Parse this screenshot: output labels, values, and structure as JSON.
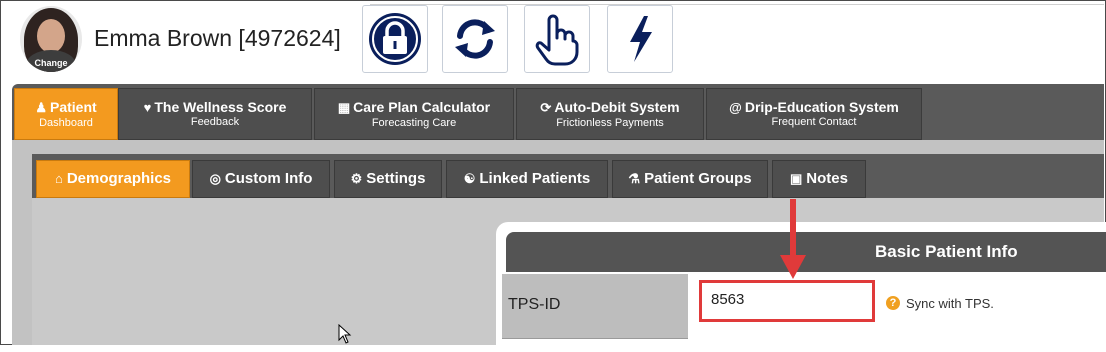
{
  "header": {
    "avatar_label": "Change",
    "patient_name": "Emma Brown [4972624]",
    "tools": [
      {
        "icon": "lock-icon"
      },
      {
        "icon": "refresh-icon"
      },
      {
        "icon": "hand-pointer-icon"
      },
      {
        "icon": "lightning-icon"
      }
    ]
  },
  "main_tabs": [
    {
      "icon": "user-icon",
      "title": "Patient",
      "subtitle": "Dashboard",
      "active": true
    },
    {
      "icon": "heartbeat-icon",
      "title": "The Wellness Score",
      "subtitle": "Feedback",
      "active": false
    },
    {
      "icon": "calculator-icon",
      "title": "Care Plan Calculator",
      "subtitle": "Forecasting Care",
      "active": false
    },
    {
      "icon": "sync-icon",
      "title": "Auto-Debit System",
      "subtitle": "Frictionless Payments",
      "active": false
    },
    {
      "icon": "at-icon",
      "title": "Drip-Education System",
      "subtitle": "Frequent Contact",
      "active": false
    }
  ],
  "sub_tabs": [
    {
      "icon": "home-icon",
      "label": "Demographics",
      "active": true
    },
    {
      "icon": "bullseye-icon",
      "label": "Custom Info",
      "active": false
    },
    {
      "icon": "gear-icon",
      "label": "Settings",
      "active": false
    },
    {
      "icon": "users-icon",
      "label": "Linked Patients",
      "active": false
    },
    {
      "icon": "flask-icon",
      "label": "Patient Groups",
      "active": false
    },
    {
      "icon": "note-icon",
      "label": "Notes",
      "active": false
    }
  ],
  "card": {
    "title": "Basic Patient Info",
    "field_label": "TPS-ID",
    "field_value": "8563",
    "help_text": "Sync with TPS."
  },
  "colors": {
    "accent": "#f39a1f",
    "tab_dark": "#4e4e4e",
    "highlight": "#e03a3a",
    "icon_navy": "#0a1f5c"
  }
}
